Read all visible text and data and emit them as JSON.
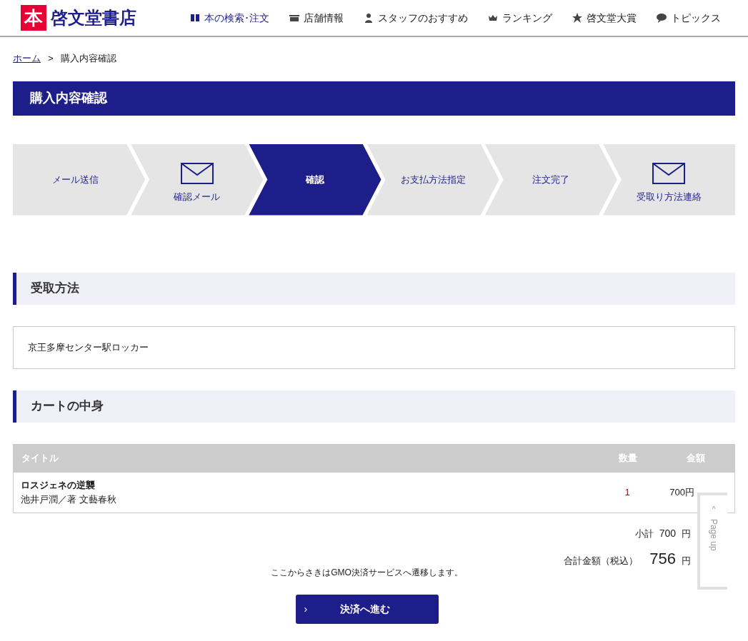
{
  "header": {
    "logo_mark": "本",
    "logo_text": "啓文堂書店",
    "nav": [
      {
        "label": "本の検索･注文",
        "kind": "book",
        "selected": true
      },
      {
        "label": "店舗情報",
        "kind": "store",
        "selected": false
      },
      {
        "label": "スタッフのおすすめ",
        "kind": "person",
        "selected": false
      },
      {
        "label": "ランキング",
        "kind": "crown",
        "selected": false
      },
      {
        "label": "啓文堂大賞",
        "kind": "star",
        "selected": false
      },
      {
        "label": "トピックス",
        "kind": "chat",
        "selected": false
      }
    ]
  },
  "breadcrumb": {
    "home": "ホーム",
    "separator": ">",
    "current": "購入内容確認"
  },
  "page_title": "購入内容確認",
  "steps": [
    {
      "label": "メール送信",
      "kind": "plain",
      "selected": false
    },
    {
      "label": "確認メール",
      "kind": "mail",
      "selected": false
    },
    {
      "label": "確認",
      "kind": "plain",
      "selected": true
    },
    {
      "label": "お支払方法指定",
      "kind": "plain",
      "selected": false
    },
    {
      "label": "注文完了",
      "kind": "plain",
      "selected": false
    },
    {
      "label": "受取り方法連絡",
      "kind": "mail",
      "selected": false
    }
  ],
  "pickup": {
    "heading": "受取方法",
    "value": "京王多摩センター駅ロッカー"
  },
  "cart": {
    "heading": "カートの中身",
    "columns": [
      "タイトル",
      "数量",
      "金額"
    ],
    "rows": [
      {
        "title": "ロスジェネの逆襲",
        "author": "池井戸潤／著 文藝春秋",
        "quantity": "1",
        "price": "700円"
      }
    ],
    "subtotal_label": "小計",
    "subtotal": "700",
    "subtotal_unit": "円",
    "total_label": "合計金額（税込）",
    "total": "756",
    "total_unit": "円"
  },
  "notice": "ここからさきはGMO決済サービスへ遷移します。",
  "pay_button": {
    "arrow": "›",
    "label": "決済へ進む"
  },
  "page_up": {
    "arrow": "^",
    "label": "Page up"
  }
}
